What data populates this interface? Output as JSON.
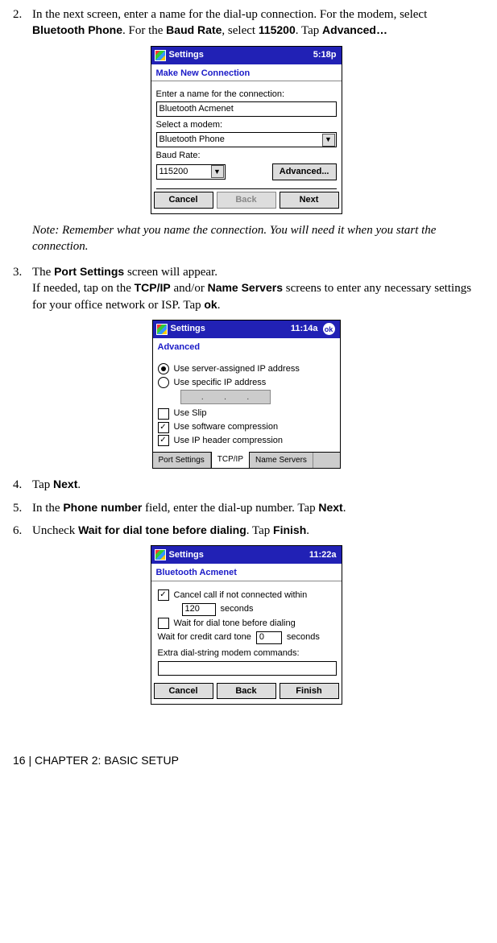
{
  "step2": {
    "num": "2.",
    "text_a": "In the next screen, enter a name for the dial-up connection. For the modem, select ",
    "b1": "Bluetooth Phone",
    "text_b": ". For the ",
    "b2": "Baud Rate",
    "text_c": ", select ",
    "b3": "115200",
    "text_d": ". Tap ",
    "b4": "Advanced…"
  },
  "ss1": {
    "title": "Settings",
    "time": "5:18p",
    "subheader": "Make New Connection",
    "name_label": "Enter a name for the connection:",
    "name_value": "Bluetooth Acmenet",
    "modem_label": "Select a modem:",
    "modem_value": "Bluetooth Phone",
    "baud_label": "Baud Rate:",
    "baud_value": "115200",
    "advanced": "Advanced...",
    "cancel": "Cancel",
    "back": "Back",
    "next": "Next"
  },
  "note": "Note: Remember what you name the connection. You will need it when you start the connection.",
  "step3": {
    "num": "3.",
    "a": "The ",
    "b1": "Port Settings",
    "b": " screen will appear.",
    "c": "If needed, tap on the ",
    "b2": "TCP/IP",
    "d": " and/or ",
    "b3": "Name Servers",
    "e": " screens to enter any necessary settings for your office network or ISP. Tap ",
    "b4": "ok",
    "f": "."
  },
  "ss2": {
    "title": "Settings",
    "time": "11:14a",
    "ok": "ok",
    "subheader": "Advanced",
    "r1": "Use server-assigned IP address",
    "r2": "Use specific IP address",
    "ip_dots": "·   ·   ·",
    "c1": "Use Slip",
    "c2": "Use software compression",
    "c3": "Use IP header compression",
    "tab1": "Port Settings",
    "tab2": "TCP/IP",
    "tab3": "Name Servers"
  },
  "step4": {
    "num": "4.",
    "a": "Tap ",
    "b1": "Next",
    "b": "."
  },
  "step5": {
    "num": "5.",
    "a": "In the ",
    "b1": "Phone number",
    "b": " field, enter the dial-up number. Tap ",
    "b2": "Next",
    "c": "."
  },
  "step6": {
    "num": "6.",
    "a": "Uncheck ",
    "b1": "Wait for dial tone before dialing",
    "b": ". Tap ",
    "b2": "Finish",
    "c": "."
  },
  "ss3": {
    "title": "Settings",
    "time": "11:22a",
    "subheader": "Bluetooth Acmenet",
    "c1": "Cancel call if not connected within",
    "c1_val": "120",
    "c1_unit": "seconds",
    "c2": "Wait for dial tone before dialing",
    "wait_label": "Wait for credit card tone",
    "wait_val": "0",
    "wait_unit": "seconds",
    "extra": "Extra dial-string modem commands:",
    "cancel": "Cancel",
    "back": "Back",
    "finish": "Finish"
  },
  "footer": "16 | CHAPTER 2: BASIC SETUP"
}
